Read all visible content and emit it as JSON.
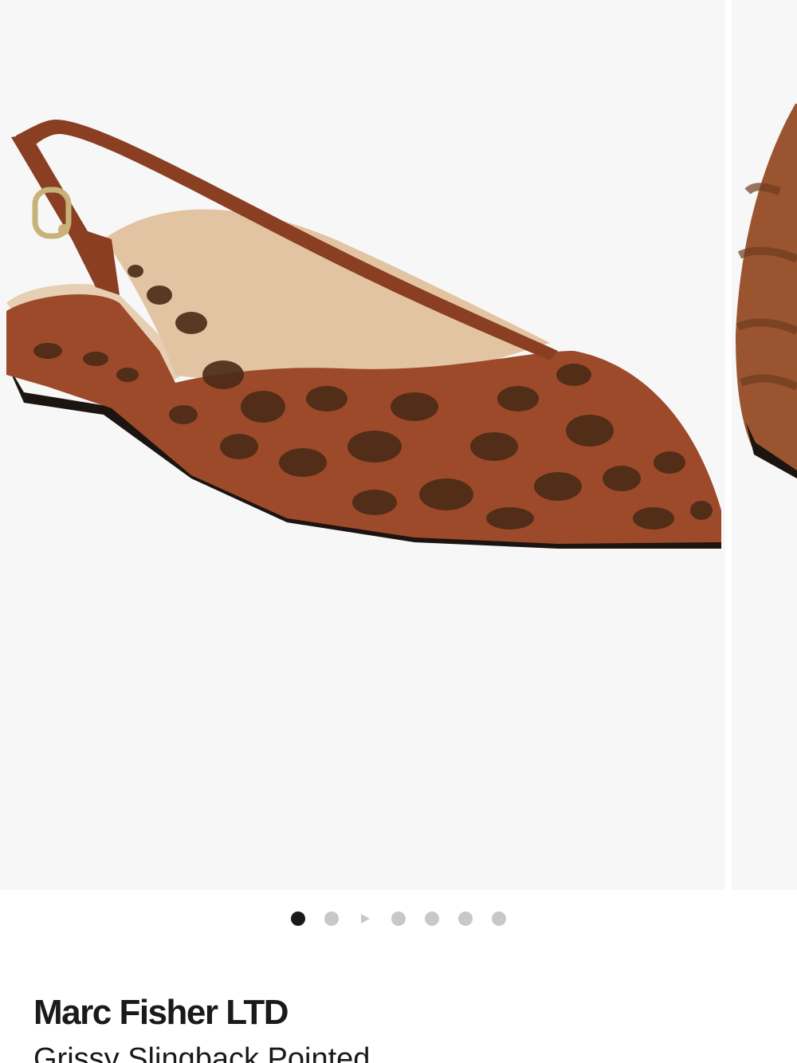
{
  "product": {
    "brand": "Marc Fisher LTD",
    "name": "Grissy Slingback Pointed"
  },
  "gallery": {
    "image_count": 7,
    "active_index": 0,
    "video_index": 2,
    "image_alt": "Marc Fisher LTD Grissy Slingback Pointed leopard print suede flat"
  },
  "colors": {
    "image_background": "#f7f7f8",
    "dot_active": "#1a1a1a",
    "dot_inactive": "#c8c8c8",
    "shoe_base": "#9c4a2a",
    "shoe_spots": "#4a2a17",
    "lining": "#e3c4a2"
  }
}
